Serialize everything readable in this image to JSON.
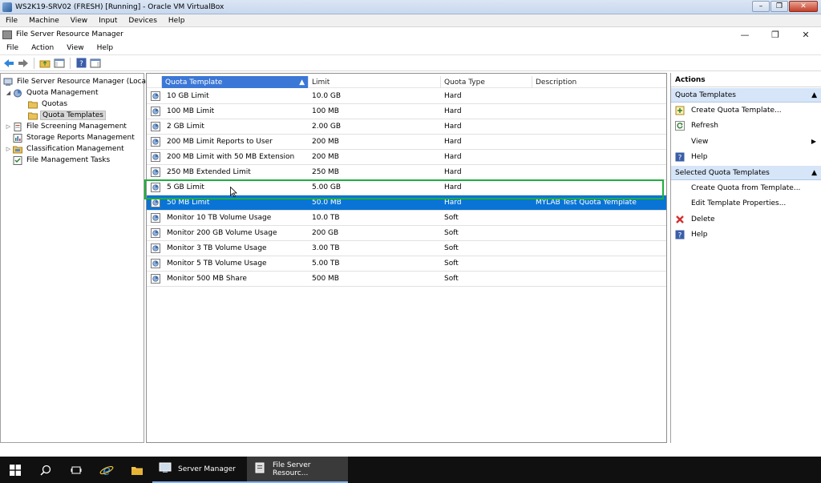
{
  "vbox": {
    "title": "WS2K19-SRV02 (FRESH) [Running] - Oracle VM VirtualBox",
    "menu": [
      "File",
      "Machine",
      "View",
      "Input",
      "Devices",
      "Help"
    ]
  },
  "guest": {
    "title": "File Server Resource Manager",
    "menu": [
      "File",
      "Action",
      "View",
      "Help"
    ]
  },
  "tree": {
    "root": "File Server Resource Manager (Local)",
    "quota_management": "Quota Management",
    "quotas": "Quotas",
    "quota_templates": "Quota Templates",
    "file_screening": "File Screening Management",
    "storage_reports": "Storage Reports Management",
    "classification": "Classification Management",
    "file_tasks": "File Management Tasks"
  },
  "list": {
    "columns": [
      "Quota Template",
      "Limit",
      "Quota Type",
      "Description"
    ],
    "rows": [
      {
        "name": "10 GB Limit",
        "limit": "10.0 GB",
        "type": "Hard",
        "desc": ""
      },
      {
        "name": "100 MB Limit",
        "limit": "100 MB",
        "type": "Hard",
        "desc": ""
      },
      {
        "name": "2 GB Limit",
        "limit": "2.00 GB",
        "type": "Hard",
        "desc": ""
      },
      {
        "name": "200 MB Limit Reports to User",
        "limit": "200 MB",
        "type": "Hard",
        "desc": ""
      },
      {
        "name": "200 MB Limit with 50 MB Extension",
        "limit": "200 MB",
        "type": "Hard",
        "desc": ""
      },
      {
        "name": "250 MB Extended Limit",
        "limit": "250 MB",
        "type": "Hard",
        "desc": ""
      },
      {
        "name": "5 GB Limit",
        "limit": "5.00 GB",
        "type": "Hard",
        "desc": ""
      },
      {
        "name": "50 MB Limit",
        "limit": "50.0 MB",
        "type": "Hard",
        "desc": "MYLAB Test Quota Yemplate"
      },
      {
        "name": "Monitor 10 TB Volume Usage",
        "limit": "10.0 TB",
        "type": "Soft",
        "desc": ""
      },
      {
        "name": "Monitor 200 GB Volume Usage",
        "limit": "200 GB",
        "type": "Soft",
        "desc": ""
      },
      {
        "name": "Monitor 3 TB Volume Usage",
        "limit": "3.00 TB",
        "type": "Soft",
        "desc": ""
      },
      {
        "name": "Monitor 5 TB Volume Usage",
        "limit": "5.00 TB",
        "type": "Soft",
        "desc": ""
      },
      {
        "name": "Monitor 500 MB Share",
        "limit": "500 MB",
        "type": "Soft",
        "desc": ""
      }
    ]
  },
  "actions": {
    "title": "Actions",
    "section1": "Quota Templates",
    "create": "Create Quota Template...",
    "refresh": "Refresh",
    "view": "View",
    "help1": "Help",
    "section2": "Selected Quota Templates",
    "create_from": "Create Quota from Template...",
    "edit": "Edit Template Properties...",
    "delete": "Delete",
    "help2": "Help"
  },
  "taskbar": {
    "server_manager": "Server Manager",
    "fsrm": "File Server Resourc..."
  },
  "colors": {
    "selection": "#0a74d6",
    "highlight_box": "#1fae3e",
    "actions_section": "#d6e5f8"
  }
}
